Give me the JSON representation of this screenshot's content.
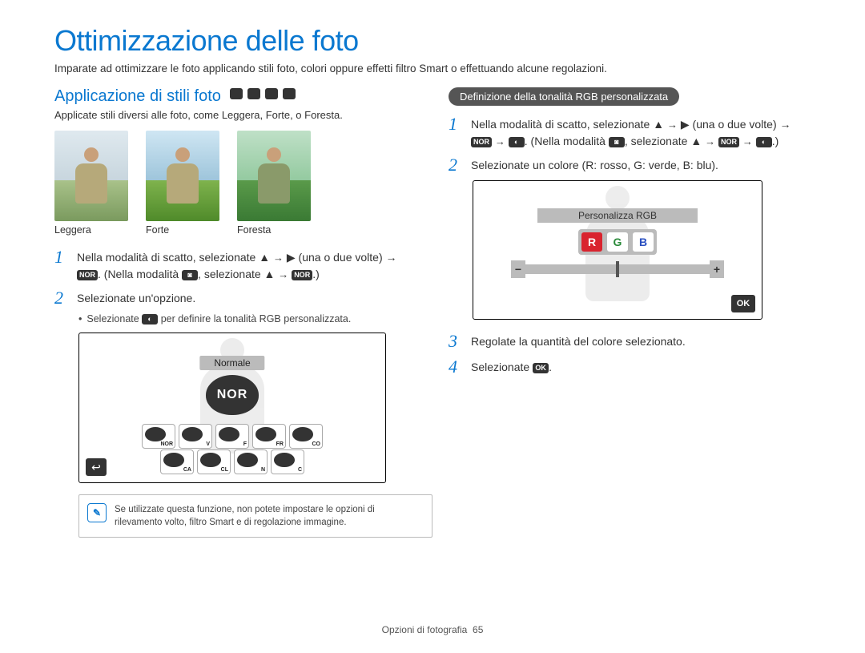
{
  "title": "Ottimizzazione delle foto",
  "intro": "Imparate ad ottimizzare le foto applicando stili foto, colori oppure effetti filtro Smart o effettuando alcune regolazioni.",
  "left": {
    "heading": "Applicazione di stili foto",
    "heading_icons": [
      "camera-auto-icon",
      "camera-p-icon",
      "scene-icon",
      "video-icon"
    ],
    "desc": "Applicate stili diversi alle foto, come Leggera, Forte, o Foresta.",
    "thumbs": {
      "a": "Leggera",
      "b": "Forte",
      "c": "Foresta"
    },
    "step1_a": "Nella modalità di scatto, selezionate ",
    "step1_b": " (una o due volte) → ",
    "step1_c": ". (Nella modalità ",
    "step1_d": ", selezionate ",
    "step1_e": ".)",
    "step2": "Selezionate un'opzione.",
    "step2_sub": "Selezionate        per definire la tonalità RGB personalizzata.",
    "step2_sub_pre": "Selezionate ",
    "step2_sub_post": " per definire la tonalità RGB personalizzata.",
    "icon_sub_name": "custom-rgb-icon",
    "screen_label": "Normale",
    "screen_big": "NOR",
    "palette_r1": [
      "NOR",
      "V",
      "F",
      "FR",
      "CO"
    ],
    "palette_r2": [
      "CA",
      "CL",
      "N",
      "C"
    ],
    "note": "Se utilizzate questa funzione, non potete impostare le opzioni di rilevamento volto, filtro Smart e di regolazione immagine."
  },
  "right": {
    "pill": "Definizione della tonalità RGB personalizzata",
    "step1_a": "Nella modalità di scatto, selezionate ",
    "step1_b": " (una o due volte) → ",
    "step1_c": ". (Nella modalità ",
    "step1_d": ", selezionate ",
    "step1_e": ".)",
    "step2": "Selezionate un colore (R: rosso, G: verde, B: blu).",
    "rgb_title": "Personalizza RGB",
    "rgb_r": "R",
    "rgb_g": "G",
    "rgb_b": "B",
    "ok": "OK",
    "step3": "Regolate la quantità del colore selezionato.",
    "step4_a": "Selezionate ",
    "step4_b": "."
  },
  "footer_section": "Opzioni di fotografia",
  "footer_page": "65"
}
